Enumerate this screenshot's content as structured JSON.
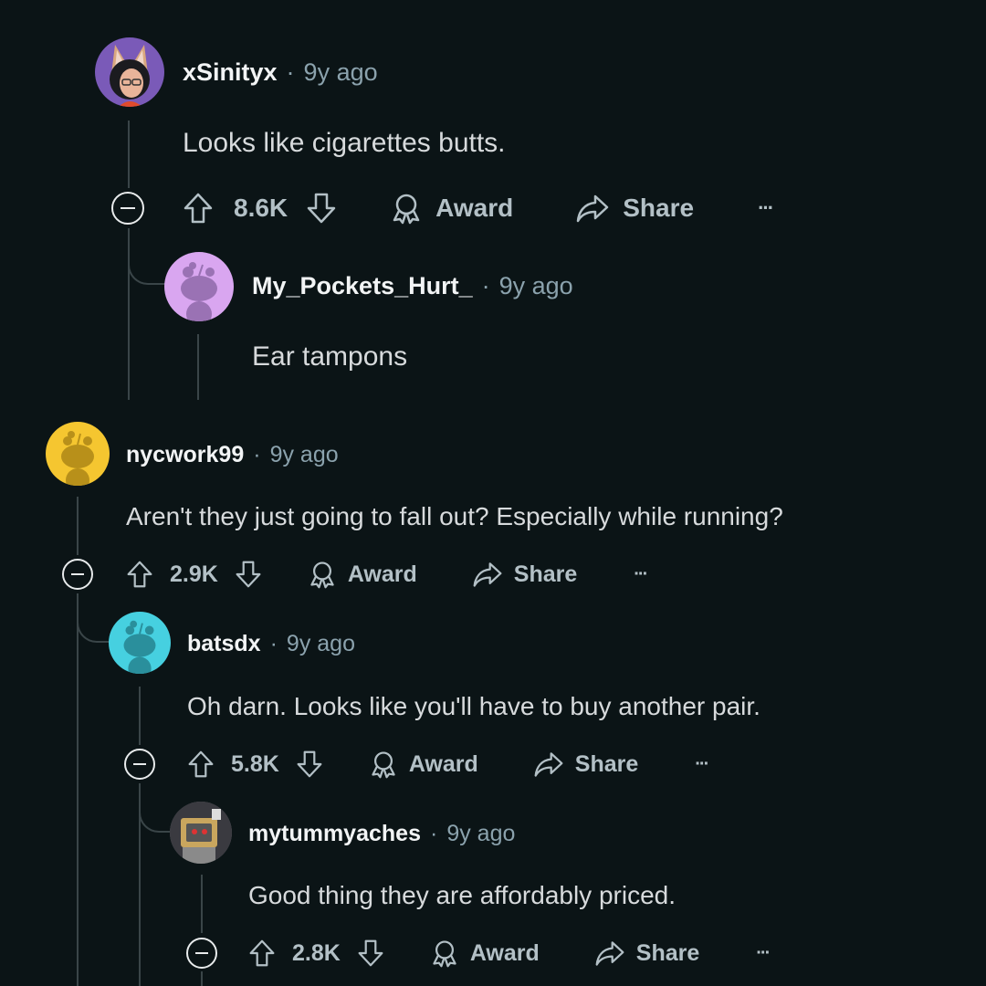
{
  "comments": [
    {
      "username": "xSinityx",
      "sep": "·",
      "time": "9y ago",
      "text": "Looks like cigarettes butts.",
      "votes": "8.6K",
      "award": "Award",
      "share": "Share",
      "more": "···",
      "avatar_color": "#7a5ab8"
    },
    {
      "username": "My_Pockets_Hurt_",
      "sep": "·",
      "time": "9y ago",
      "text": "Ear tampons",
      "avatar_color": "#d9a6f0"
    },
    {
      "username": "nycwork99",
      "sep": "·",
      "time": "9y ago",
      "text": "Aren't they just going to fall out? Especially while running?",
      "votes": "2.9K",
      "award": "Award",
      "share": "Share",
      "more": "···",
      "avatar_color": "#f5c630"
    },
    {
      "username": "batsdx",
      "sep": "·",
      "time": "9y ago",
      "text": "Oh darn. Looks like you'll have to buy another pair.",
      "votes": "5.8K",
      "award": "Award",
      "share": "Share",
      "more": "···",
      "avatar_color": "#46d0e0"
    },
    {
      "username": "mytummyaches",
      "sep": "·",
      "time": "9y ago",
      "text": "Good thing they are affordably priced.",
      "votes": "2.8K",
      "award": "Award",
      "share": "Share",
      "more": "···",
      "avatar_color": "#6b6a70"
    }
  ]
}
